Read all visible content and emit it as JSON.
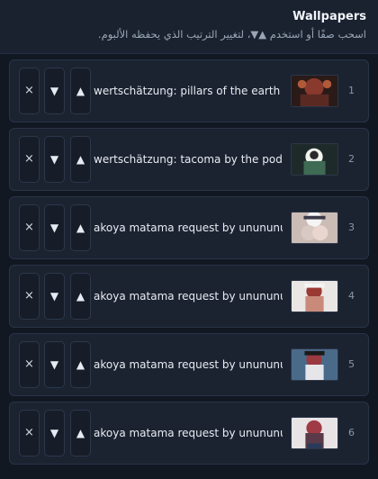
{
  "header": {
    "title": "Wallpapers",
    "subtitle": "اسحب صفًا أو استخدم ▲▼، لتغيير الترتيب الذي يحفظه الألبوم."
  },
  "icons": {
    "up": "▲",
    "down": "▼",
    "remove": "×"
  },
  "items": [
    {
      "index": "1",
      "name": "wertschätzung: pillars of the earth by...",
      "thumb_color": "#8a3a2c"
    },
    {
      "index": "2",
      "name": "wertschätzung: tacoma by the pod fr...",
      "thumb_color": "#3f6a54"
    },
    {
      "index": "3",
      "name": "akoya matama request by unununun...",
      "thumb_color": "#d8c9c2"
    },
    {
      "index": "4",
      "name": "akoya matama request by unununun...",
      "thumb_color": "#c98a7a"
    },
    {
      "index": "5",
      "name": "akoya matama request by unununun...",
      "thumb_color": "#4a6a8a"
    },
    {
      "index": "6",
      "name": "akoya matama request by unununun...",
      "thumb_color": "#5a3a48"
    }
  ]
}
